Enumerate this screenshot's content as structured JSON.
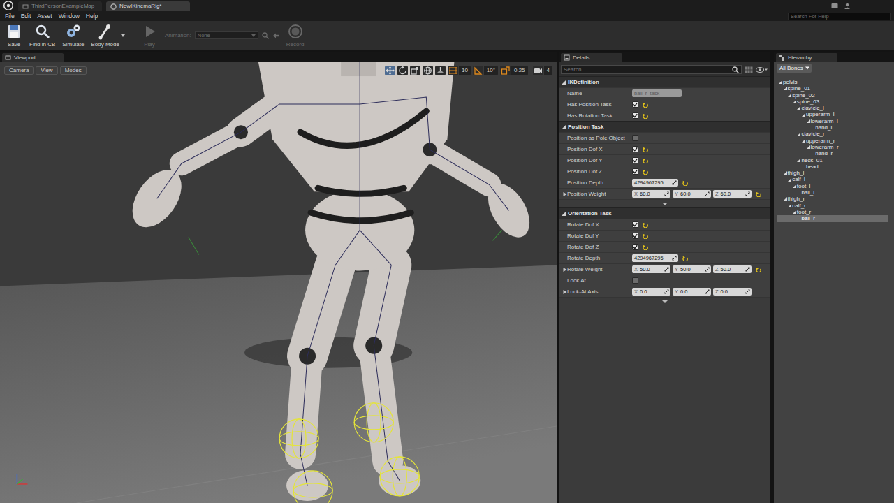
{
  "window": {
    "tabs": [
      {
        "label": "ThirdPersonExampleMap",
        "selected": false
      },
      {
        "label": "NewIKinemaRig*",
        "selected": true
      }
    ]
  },
  "menu": [
    "File",
    "Edit",
    "Asset",
    "Window",
    "Help"
  ],
  "help_search": {
    "placeholder": "Search For Help"
  },
  "toolbar": [
    {
      "kind": "save",
      "label": "Save",
      "disabled": false
    },
    {
      "kind": "browse",
      "label": "Find in CB",
      "disabled": false
    },
    {
      "kind": "simulate",
      "label": "Simulate",
      "disabled": false
    },
    {
      "kind": "mode",
      "label": "Body Mode",
      "disabled": false
    },
    {
      "kind": "play",
      "label": "Play",
      "disabled": true
    },
    {
      "kind": "picker",
      "label": "Animation:",
      "value": "None",
      "disabled": true
    },
    {
      "kind": "record",
      "label": "Record",
      "disabled": true
    }
  ],
  "viewport": {
    "tab": "Viewport",
    "buttons": [
      "Camera",
      "View",
      "Modes"
    ],
    "tools": [
      {
        "kind": "translate",
        "selected": true
      },
      {
        "kind": "rotate",
        "selected": false
      },
      {
        "kind": "scale",
        "selected": false
      }
    ],
    "snaps": [
      {
        "kind": "grid",
        "value": "10",
        "on": true
      },
      {
        "kind": "angle",
        "value": "10°",
        "on": true
      },
      {
        "kind": "scale",
        "value": "0.25",
        "on": true
      }
    ],
    "camera_speed": "4"
  },
  "details": {
    "tab": "Details",
    "search": {
      "placeholder": "Search"
    },
    "sections": [
      {
        "title": "IKDefinition",
        "expanded": true,
        "rows": [
          {
            "kind": "text",
            "label": "Name",
            "value": "ball_r_task",
            "disabled": true,
            "modified": false
          },
          {
            "kind": "check",
            "label": "Has Position Task",
            "checked": true,
            "modified": true
          },
          {
            "kind": "check",
            "label": "Has Rotation Task",
            "checked": true,
            "modified": true
          }
        ]
      },
      {
        "title": "Position Task",
        "expanded": true,
        "advanced_expanded": false,
        "rows": [
          {
            "kind": "check",
            "label": "Position as Pole Object",
            "checked": false,
            "modified": false
          },
          {
            "kind": "check",
            "label": "Position Dof X",
            "checked": true,
            "modified": true
          },
          {
            "kind": "check",
            "label": "Position Dof Y",
            "checked": true,
            "modified": true
          },
          {
            "kind": "check",
            "label": "Position Dof Z",
            "checked": true,
            "modified": true
          },
          {
            "kind": "number",
            "label": "Position Depth",
            "value": "4294967295",
            "modified": true
          },
          {
            "kind": "vector",
            "label": "Position Weight",
            "expanded": false,
            "modified": true,
            "values": [
              {
                "axis": "X",
                "value": "60.0"
              },
              {
                "axis": "Y",
                "value": "60.0"
              },
              {
                "axis": "Z",
                "value": "60.0"
              }
            ]
          }
        ]
      },
      {
        "title": "Orientation Task",
        "expanded": true,
        "advanced_expanded": false,
        "rows": [
          {
            "kind": "check",
            "label": "Rotate Dof X",
            "checked": true,
            "modified": true
          },
          {
            "kind": "check",
            "label": "Rotate Dof Y",
            "checked": true,
            "modified": true
          },
          {
            "kind": "check",
            "label": "Rotate Dof Z",
            "checked": true,
            "modified": true
          },
          {
            "kind": "number",
            "label": "Rotate Depth",
            "value": "4294967295",
            "modified": true
          },
          {
            "kind": "vector",
            "label": "Rotate Weight",
            "expanded": false,
            "modified": true,
            "values": [
              {
                "axis": "X",
                "value": "50.0"
              },
              {
                "axis": "Y",
                "value": "50.0"
              },
              {
                "axis": "Z",
                "value": "50.0"
              }
            ]
          },
          {
            "kind": "check",
            "label": "Look At",
            "checked": false,
            "modified": false
          },
          {
            "kind": "vector",
            "label": "Look-At Axis",
            "expanded": false,
            "modified": false,
            "values": [
              {
                "axis": "X",
                "value": "0.0"
              },
              {
                "axis": "Y",
                "value": "0.0"
              },
              {
                "axis": "Z",
                "value": "0.0"
              }
            ]
          }
        ]
      }
    ]
  },
  "hierarchy": {
    "tab": "Hierarchy",
    "filter": "All Bones",
    "items": [
      {
        "label": "pelvis",
        "selected": false,
        "expanded": true,
        "children": [
          {
            "label": "spine_01",
            "selected": false,
            "expanded": true,
            "children": [
              {
                "label": "spine_02",
                "selected": false,
                "expanded": true,
                "children": [
                  {
                    "label": "spine_03",
                    "selected": false,
                    "expanded": true,
                    "children": [
                      {
                        "label": "clavicle_l",
                        "selected": false,
                        "expanded": true,
                        "children": [
                          {
                            "label": "upperarm_l",
                            "selected": false,
                            "expanded": true,
                            "children": [
                              {
                                "label": "lowerarm_l",
                                "selected": false,
                                "expanded": true,
                                "children": [
                                  {
                                    "label": "hand_l",
                                    "selected": false
                                  }
                                ]
                              }
                            ]
                          }
                        ]
                      },
                      {
                        "label": "clavicle_r",
                        "selected": false,
                        "expanded": true,
                        "children": [
                          {
                            "label": "upperarm_r",
                            "selected": false,
                            "expanded": true,
                            "children": [
                              {
                                "label": "lowerarm_r",
                                "selected": false,
                                "expanded": true,
                                "children": [
                                  {
                                    "label": "hand_r",
                                    "selected": false
                                  }
                                ]
                              }
                            ]
                          }
                        ]
                      },
                      {
                        "label": "neck_01",
                        "selected": false,
                        "expanded": true,
                        "children": [
                          {
                            "label": "head",
                            "selected": false
                          }
                        ]
                      }
                    ]
                  }
                ]
              }
            ]
          },
          {
            "label": "thigh_l",
            "selected": false,
            "expanded": true,
            "children": [
              {
                "label": "calf_l",
                "selected": false,
                "expanded": true,
                "children": [
                  {
                    "label": "foot_l",
                    "selected": false,
                    "expanded": true,
                    "children": [
                      {
                        "label": "ball_l",
                        "selected": false
                      }
                    ]
                  }
                ]
              }
            ]
          },
          {
            "label": "thigh_r",
            "selected": false,
            "expanded": true,
            "children": [
              {
                "label": "calf_r",
                "selected": false,
                "expanded": true,
                "children": [
                  {
                    "label": "foot_r",
                    "selected": false,
                    "expanded": true,
                    "children": [
                      {
                        "label": "ball_r",
                        "selected": true
                      }
                    ]
                  }
                ]
              }
            ]
          }
        ]
      }
    ]
  }
}
